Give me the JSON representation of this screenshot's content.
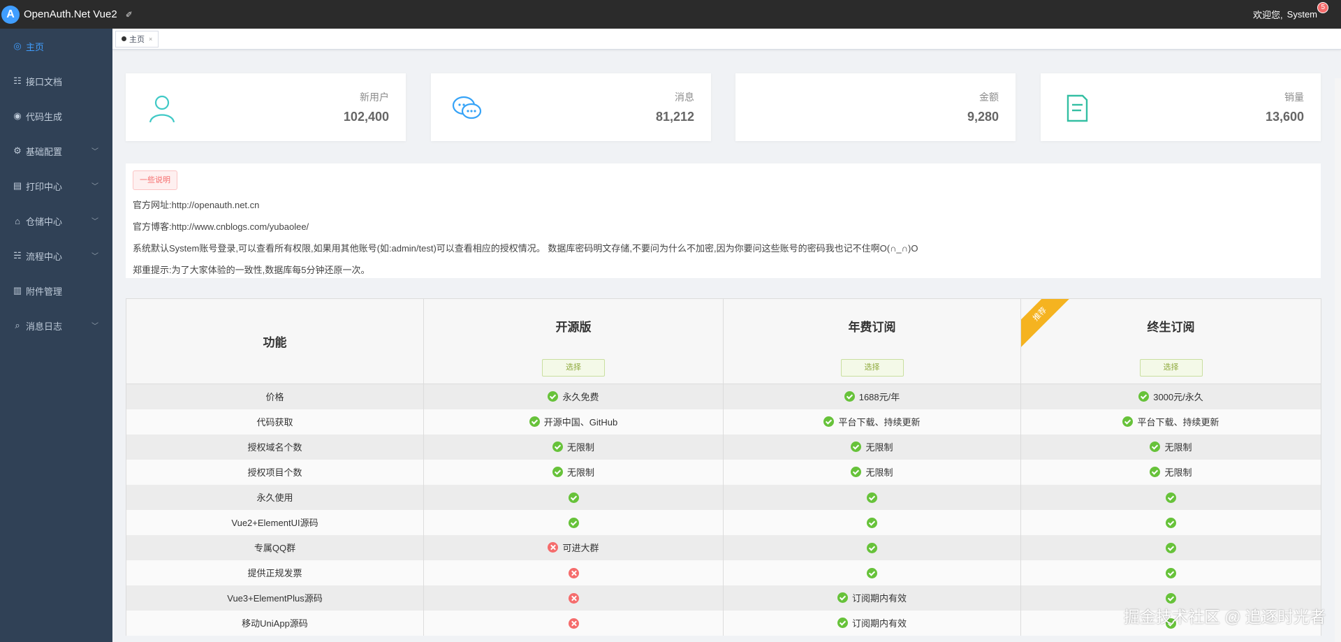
{
  "header": {
    "app_title": "OpenAuth.Net Vue2",
    "logo_icon": "logo-icon",
    "pin_icon": "pin-icon",
    "welcome": "欢迎您,",
    "user": "System",
    "badge_count": "5"
  },
  "sidebar": {
    "items": [
      {
        "label": "主页",
        "icon": "home-icon",
        "active": true
      },
      {
        "label": "接口文档",
        "icon": "api-doc-icon"
      },
      {
        "label": "代码生成",
        "icon": "code-gen-icon"
      },
      {
        "label": "基础配置",
        "icon": "gear-icon",
        "expandable": true
      },
      {
        "label": "打印中心",
        "icon": "print-icon",
        "expandable": true
      },
      {
        "label": "仓储中心",
        "icon": "warehouse-icon",
        "expandable": true
      },
      {
        "label": "流程中心",
        "icon": "flow-icon",
        "expandable": true
      },
      {
        "label": "附件管理",
        "icon": "attachment-icon"
      },
      {
        "label": "消息日志",
        "icon": "search-icon",
        "expandable": true
      }
    ]
  },
  "tags": {
    "home": "主页",
    "close": "×"
  },
  "stats": [
    {
      "label": "新用户",
      "value": "102,400",
      "icon": "user-icon",
      "color": "#40c9c6"
    },
    {
      "label": "消息",
      "value": "81,212",
      "icon": "message-icon",
      "color": "#36a3f7"
    },
    {
      "label": "金额",
      "value": "9,280",
      "icon": "money-icon",
      "color": "#f4516c"
    },
    {
      "label": "销量",
      "value": "13,600",
      "icon": "document-icon",
      "color": "#34bfa3"
    }
  ],
  "notice": {
    "tag": "一些说明",
    "lines": [
      "官方网址:http://openauth.net.cn",
      "官方博客:http://www.cnblogs.com/yubaolee/",
      "系统默认System账号登录,可以查看所有权限,如果用其他账号(如:admin/test)可以查看相应的授权情况。 数据库密码明文存储,不要问为什么不加密,因为你要问这些账号的密码我也记不住啊O(∩_∩)O",
      "郑重提示:为了大家体验的一致性,数据库每5分钟还原一次。"
    ]
  },
  "pricing": {
    "feature_header": "功能",
    "plans": [
      {
        "name": "开源版",
        "select": "选择"
      },
      {
        "name": "年费订阅",
        "select": "选择"
      },
      {
        "name": "终生订阅",
        "select": "选择",
        "ribbon": "推荐"
      }
    ],
    "rows": [
      {
        "feature": "价格",
        "cells": [
          [
            "ok",
            "永久免费"
          ],
          [
            "ok",
            "1688元/年"
          ],
          [
            "ok",
            "3000元/永久"
          ]
        ]
      },
      {
        "feature": "代码获取",
        "cells": [
          [
            "ok",
            "开源中国、GitHub"
          ],
          [
            "ok",
            "平台下载、持续更新"
          ],
          [
            "ok",
            "平台下载、持续更新"
          ]
        ]
      },
      {
        "feature": "授权域名个数",
        "cells": [
          [
            "ok",
            "无限制"
          ],
          [
            "ok",
            "无限制"
          ],
          [
            "ok",
            "无限制"
          ]
        ]
      },
      {
        "feature": "授权项目个数",
        "cells": [
          [
            "ok",
            "无限制"
          ],
          [
            "ok",
            "无限制"
          ],
          [
            "ok",
            "无限制"
          ]
        ]
      },
      {
        "feature": "永久使用",
        "cells": [
          [
            "ok",
            ""
          ],
          [
            "ok",
            ""
          ],
          [
            "ok",
            ""
          ]
        ]
      },
      {
        "feature": "Vue2+ElementUI源码",
        "cells": [
          [
            "ok",
            ""
          ],
          [
            "ok",
            ""
          ],
          [
            "ok",
            ""
          ]
        ]
      },
      {
        "feature": "专属QQ群",
        "cells": [
          [
            "no",
            "可进大群"
          ],
          [
            "ok",
            ""
          ],
          [
            "ok",
            ""
          ]
        ]
      },
      {
        "feature": "提供正规发票",
        "cells": [
          [
            "no",
            ""
          ],
          [
            "ok",
            ""
          ],
          [
            "ok",
            ""
          ]
        ]
      },
      {
        "feature": "Vue3+ElementPlus源码",
        "cells": [
          [
            "no",
            ""
          ],
          [
            "ok",
            "订阅期内有效"
          ],
          [
            "ok",
            ""
          ]
        ]
      },
      {
        "feature": "移动UniApp源码",
        "cells": [
          [
            "no",
            ""
          ],
          [
            "ok",
            "订阅期内有效"
          ],
          [
            "ok",
            ""
          ]
        ]
      }
    ]
  },
  "watermark": "掘金技术社区 @ 追逐时光者"
}
